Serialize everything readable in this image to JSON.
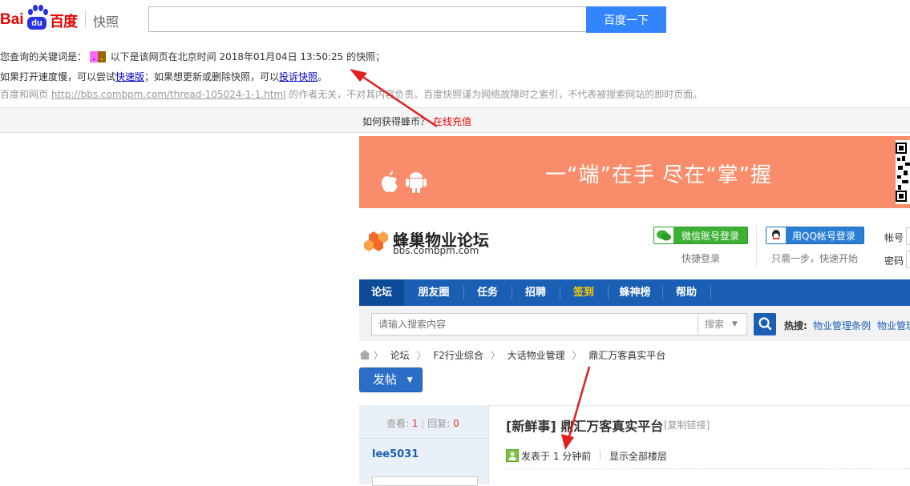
{
  "baidu": {
    "logo_left": "Bai",
    "logo_du": "du",
    "logo_right": "百度",
    "product": "快照",
    "search_button": "百度一下",
    "search_value": ""
  },
  "notice": {
    "line1_prefix": "您查询的关键词是：",
    "keyword_1": ".",
    "keyword_2": ".",
    "line1_suffix": "以下是该网页在北京时间 2018年01月04日 13:50:25 的快照；",
    "line2_a": "如果打开速度慢，可以尝试",
    "line2_link1": "快速版",
    "line2_b": "；如果想更新或删除快照，可以",
    "line2_link2": "投诉快照",
    "line2_c": "。",
    "line3_a": "百度和网页 ",
    "line3_url": "http://bbs.combpm.com/thread-105024-1-1.html",
    "line3_b": " 的作者无关，不对其内容负责。百度快照谨为网络故障时之索引，不代表被搜索网站的即时页面。"
  },
  "bar": {
    "howto": "如何获得蜂币？",
    "recharge": "在线充值"
  },
  "banner": {
    "text": "一“端”在手 尽在“掌”握",
    "bg_color": "#f98d6b"
  },
  "forum": {
    "title": "蜂巢物业论坛",
    "url": "bbs.combpm.com",
    "wx_login": "微信账号登录",
    "qq_login": "用QQ帐号登录",
    "quick_login": "快捷登录",
    "one_step": "只需一步，快速开始",
    "account_label": "帐号",
    "password_label": "密码"
  },
  "nav": {
    "items": [
      "论坛",
      "朋友圈",
      "任务",
      "招聘",
      "签到",
      "蜂神榜",
      "帮助"
    ],
    "active_color": "#0d4a97",
    "bar_color": "#1a5fb4"
  },
  "search": {
    "placeholder": "请输入搜索内容",
    "type": "搜索",
    "hot_label": "热搜:",
    "hot_items": [
      "物业管理条例",
      "物业管理"
    ]
  },
  "breadcrumb": [
    "论坛",
    "F2行业综合",
    "大话物业管理",
    "鼎汇万客真实平台"
  ],
  "post_button": "发帖",
  "thread": {
    "views_label": "查看:",
    "views": "1",
    "replies_label": "回复:",
    "replies": "0",
    "author": "lee5031",
    "title": "[新鲜事] 鼎汇万客真实平台",
    "copy_link": "[复制链接]",
    "posted": "发表于 1 分钟前",
    "show_all": "显示全部楼层"
  }
}
